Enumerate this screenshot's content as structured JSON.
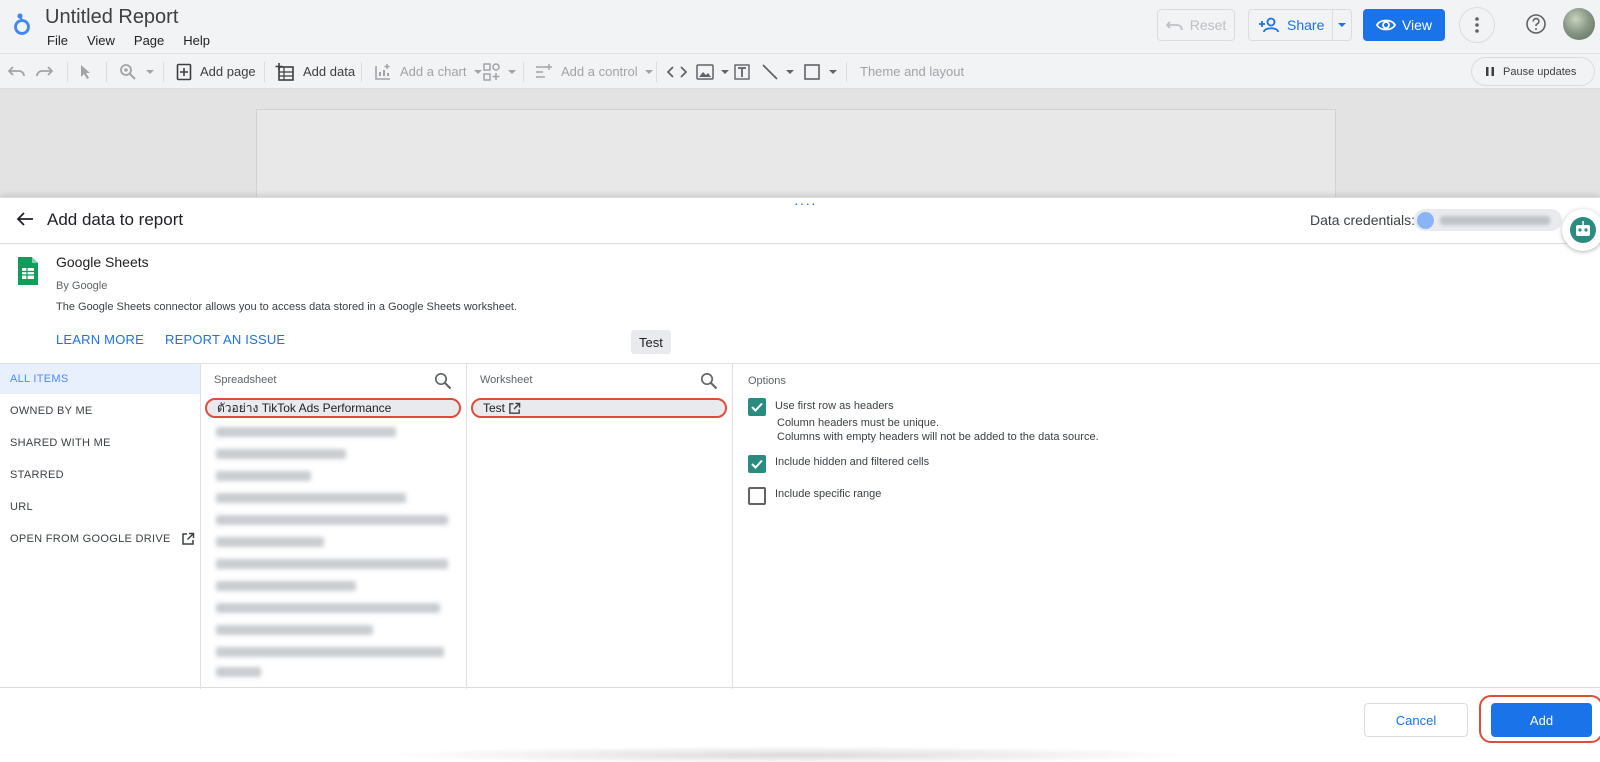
{
  "app": {
    "title": "Untitled Report",
    "menu": [
      "File",
      "View",
      "Page",
      "Help"
    ],
    "header_buttons": {
      "reset": "Reset",
      "share": "Share",
      "view": "View"
    }
  },
  "toolbar": {
    "add_page": "Add page",
    "add_data": "Add data",
    "add_chart": "Add a chart",
    "add_control": "Add a control",
    "theme_layout": "Theme and layout",
    "pause_updates": "Pause updates"
  },
  "panel": {
    "title": "Add data to report",
    "credentials_label": "Data credentials:",
    "connector": {
      "name": "Google Sheets",
      "by": "By Google",
      "description": "The Google Sheets connector allows you to access data stored in a Google Sheets worksheet.",
      "learn_more": "LEARN MORE",
      "report_issue": "REPORT AN ISSUE"
    },
    "tooltip": "Test",
    "nav": [
      "ALL ITEMS",
      "OWNED BY ME",
      "SHARED WITH ME",
      "STARRED",
      "URL",
      "OPEN FROM GOOGLE DRIVE"
    ],
    "spreadsheet": {
      "header": "Spreadsheet",
      "selected": "ตัวอย่าง TikTok Ads Performance"
    },
    "worksheet": {
      "header": "Worksheet",
      "selected": "Test"
    },
    "options": {
      "header": "Options",
      "first_row_headers": {
        "label": "Use first row as headers",
        "checked": true
      },
      "notes": [
        "Column headers must be unique.",
        "Columns with empty headers will not be added to the data source."
      ],
      "hidden_filtered": {
        "label": "Include hidden and filtered cells",
        "checked": true
      },
      "specific_range": {
        "label": "Include specific range",
        "checked": false
      }
    },
    "buttons": {
      "cancel": "Cancel",
      "add": "Add"
    }
  },
  "colors": {
    "primary": "#1a73e8",
    "checkbox": "#2a8c80",
    "highlight": "#e04c3a",
    "sheets_green": "#0f9d58"
  },
  "icons": [
    "looker-logo-icon",
    "undo-icon",
    "redo-icon",
    "cursor-icon",
    "zoom-icon",
    "add-page-icon",
    "add-data-icon",
    "add-chart-icon",
    "controls-icon",
    "code-icon",
    "image-icon",
    "text-icon",
    "line-icon",
    "shape-icon",
    "pause-icon",
    "back-arrow-icon",
    "sheets-icon",
    "search-icon",
    "external-link-icon",
    "robot-icon",
    "help-icon",
    "more-vert-icon",
    "eye-icon",
    "person-add-icon"
  ]
}
